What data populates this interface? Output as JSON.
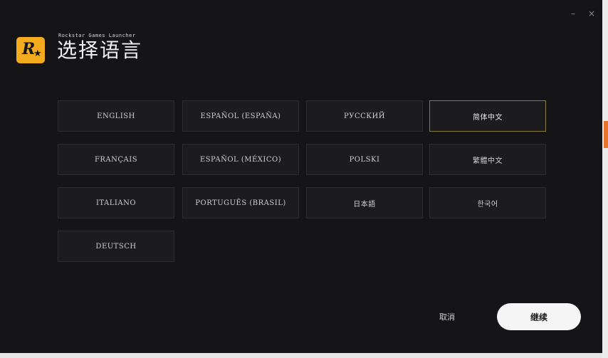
{
  "window": {
    "minimize_glyph": "–",
    "close_glyph": "×"
  },
  "header": {
    "logo_letter": "R",
    "logo_star": "★",
    "brand": "Rockstar Games Launcher",
    "title": "选择语言"
  },
  "languages": [
    {
      "label": "ENGLISH",
      "selected": false
    },
    {
      "label": "ESPAÑOL (ESPAÑA)",
      "selected": false
    },
    {
      "label": "РУССКИЙ",
      "selected": false
    },
    {
      "label": "简体中文",
      "selected": true
    },
    {
      "label": "FRANÇAIS",
      "selected": false
    },
    {
      "label": "ESPAÑOL (MÉXICO)",
      "selected": false
    },
    {
      "label": "POLSKI",
      "selected": false
    },
    {
      "label": "繁體中文",
      "selected": false
    },
    {
      "label": "ITALIANO",
      "selected": false
    },
    {
      "label": "PORTUGUÊS (BRASIL)",
      "selected": false
    },
    {
      "label": "日本語",
      "selected": false
    },
    {
      "label": "한국어",
      "selected": false
    },
    {
      "label": "DEUTSCH",
      "selected": false
    }
  ],
  "footer": {
    "cancel_label": "取消",
    "continue_label": "继续"
  },
  "colors": {
    "background": "#151517",
    "logo": "#f4ab1e",
    "selected_border": "#8a7a3e"
  }
}
